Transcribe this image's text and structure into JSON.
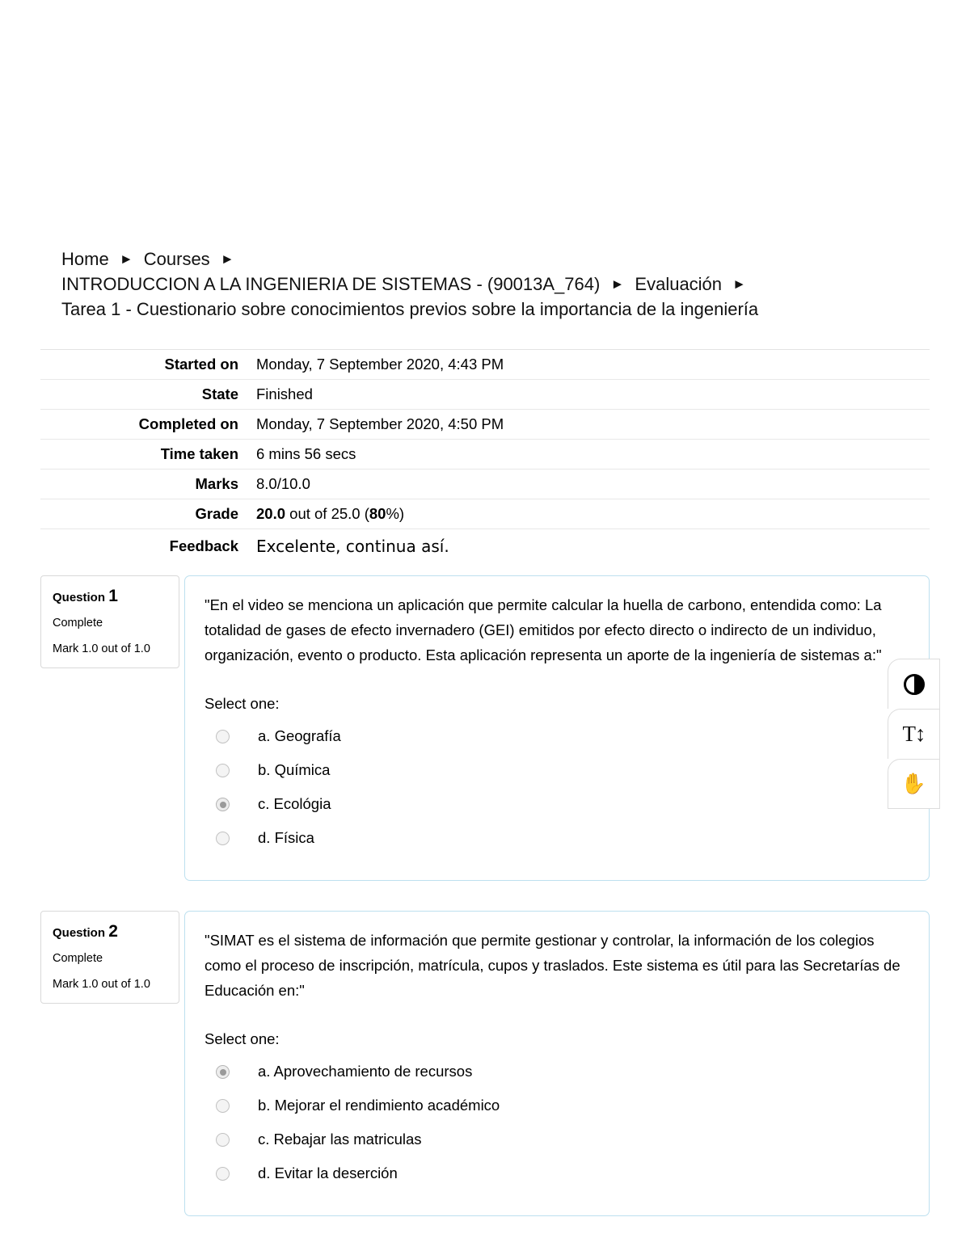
{
  "breadcrumb": {
    "separator": "►",
    "line1": [
      "Home",
      "Courses"
    ],
    "line2": [
      "INTRODUCCION A LA INGENIERIA DE SISTEMAS - (90013A_764)",
      "Evaluación"
    ],
    "line3": "Tarea 1 - Cuestionario sobre conocimientos previos sobre la importancia de la ingeniería"
  },
  "summary": {
    "rows": [
      {
        "label": "Started on",
        "value": "Monday, 7 September 2020, 4:43 PM"
      },
      {
        "label": "State",
        "value": "Finished"
      },
      {
        "label": "Completed on",
        "value": "Monday, 7 September 2020, 4:50 PM"
      },
      {
        "label": "Time taken",
        "value": "6 mins 56 secs"
      },
      {
        "label": "Marks",
        "value": "8.0/10.0"
      }
    ],
    "grade": {
      "label": "Grade",
      "value_bold": "20.0",
      "value_mid": " out of 25.0 (",
      "value_pct": "80",
      "value_end": "%)"
    },
    "feedback": {
      "label": "Feedback",
      "value": "Excelente, continua así."
    }
  },
  "questions": [
    {
      "number_label": "Question",
      "number": "1",
      "state": "Complete",
      "mark": "Mark 1.0 out of 1.0",
      "text": "\"En el video se menciona un aplicación que permite calcular la huella de carbono, entendida como: La totalidad de gases de efecto invernadero (GEI) emitidos por efecto directo o indirecto de un individuo, organización, evento o producto. Esta aplicación representa un aporte de la ingeniería de sistemas a:\"",
      "select_prompt": "Select one:",
      "answers": [
        {
          "label": "a. Geografía",
          "selected": false
        },
        {
          "label": "b. Química",
          "selected": false
        },
        {
          "label": "c. Ecológia",
          "selected": true
        },
        {
          "label": "d. Física",
          "selected": false
        }
      ]
    },
    {
      "number_label": "Question",
      "number": "2",
      "state": "Complete",
      "mark": "Mark 1.0 out of 1.0",
      "text": "\"SIMAT es el sistema de información que permite gestionar y controlar, la información de los colegios como el proceso de inscripción, matrícula, cupos y traslados. Este sistema es útil para las Secretarías de Educación en:\"",
      "select_prompt": "Select one:",
      "answers": [
        {
          "label": "a. Aprovechamiento de recursos",
          "selected": true
        },
        {
          "label": "b. Mejorar el rendimiento académico",
          "selected": false
        },
        {
          "label": "c. Rebajar las matriculas",
          "selected": false
        },
        {
          "label": "d. Evitar la deserción",
          "selected": false
        }
      ]
    }
  ],
  "accessibility_bar": {
    "buttons": [
      {
        "icon": "contrast-icon",
        "glyph": ""
      },
      {
        "icon": "text-size-icon",
        "glyph": "T↕"
      },
      {
        "icon": "sign-language-icon",
        "glyph": "✋"
      }
    ]
  },
  "colors": {
    "question_border": "#bde0ef",
    "info_border": "#d9d9d9",
    "table_divider": "#e8e8e8"
  }
}
